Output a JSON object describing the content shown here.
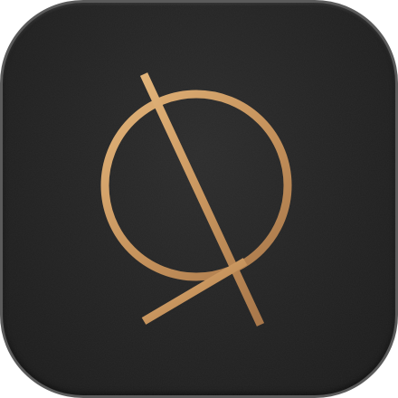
{
  "app_icon": {
    "icon": "globe-logo-icon",
    "colors": {
      "background": "#242424",
      "rim": "#5b5b5b",
      "gold_light": "#e2b47a",
      "gold": "#c8955e",
      "gold_dark": "#9c6d3f"
    }
  }
}
